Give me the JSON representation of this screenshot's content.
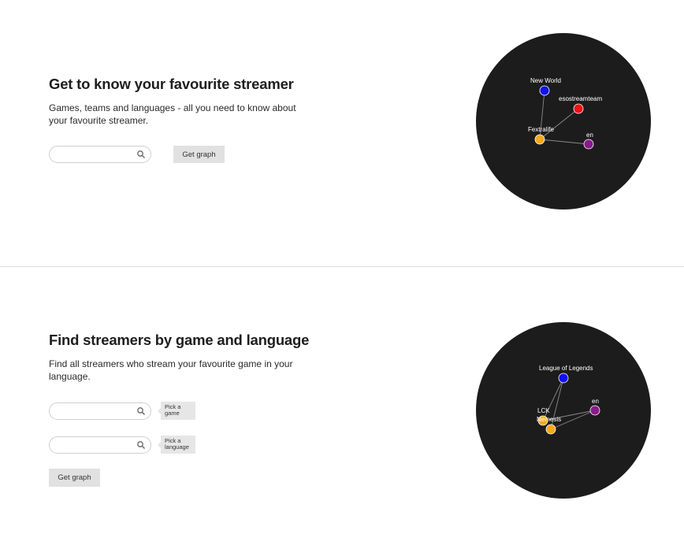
{
  "streamer_section": {
    "title": "Get to know your favourite streamer",
    "description": "Games, teams and languages - all you need to know about your favourite streamer.",
    "search": {
      "placeholder": "",
      "value": ""
    },
    "button_label": "Get graph",
    "graph": {
      "nodes": [
        {
          "id": "new-world",
          "label": "New World",
          "color": "#1111ee"
        },
        {
          "id": "esostreamteam",
          "label": "esostreamteam",
          "color": "#ee1111"
        },
        {
          "id": "fextralife",
          "label": "Fextralife",
          "color": "#f5a81c"
        },
        {
          "id": "en",
          "label": "en",
          "color": "#8b1a8b"
        }
      ],
      "edges": [
        [
          "fextralife",
          "new-world"
        ],
        [
          "fextralife",
          "esostreamteam"
        ],
        [
          "fextralife",
          "en"
        ]
      ]
    }
  },
  "search_section": {
    "title": "Find streamers by game and language",
    "description": "Find all streamers who stream your favourite game in your language.",
    "game_search": {
      "placeholder": "",
      "value": "",
      "tooltip": "Pick a game"
    },
    "language_search": {
      "placeholder": "",
      "value": "",
      "tooltip": "Pick a language"
    },
    "button_label": "Get graph",
    "graph": {
      "nodes": [
        {
          "id": "lol",
          "label": "League of Legends",
          "color": "#1111ee"
        },
        {
          "id": "en",
          "label": "en",
          "color": "#8b1a8b"
        },
        {
          "id": "lck",
          "label": "LCK",
          "color": "#f5a81c"
        },
        {
          "id": "nemesis",
          "label": "Nemesis",
          "color": "#f5a81c"
        }
      ],
      "edges": [
        [
          "lck",
          "lol"
        ],
        [
          "nemesis",
          "lol"
        ],
        [
          "lck",
          "en"
        ],
        [
          "nemesis",
          "en"
        ]
      ]
    }
  },
  "colors": {
    "graph_background": "#1c1c1d",
    "edge": "#8a8a8a",
    "button": "#e1e1e1",
    "divider": "#dcdcdc"
  },
  "icons": {
    "search": "magnifier-icon"
  }
}
